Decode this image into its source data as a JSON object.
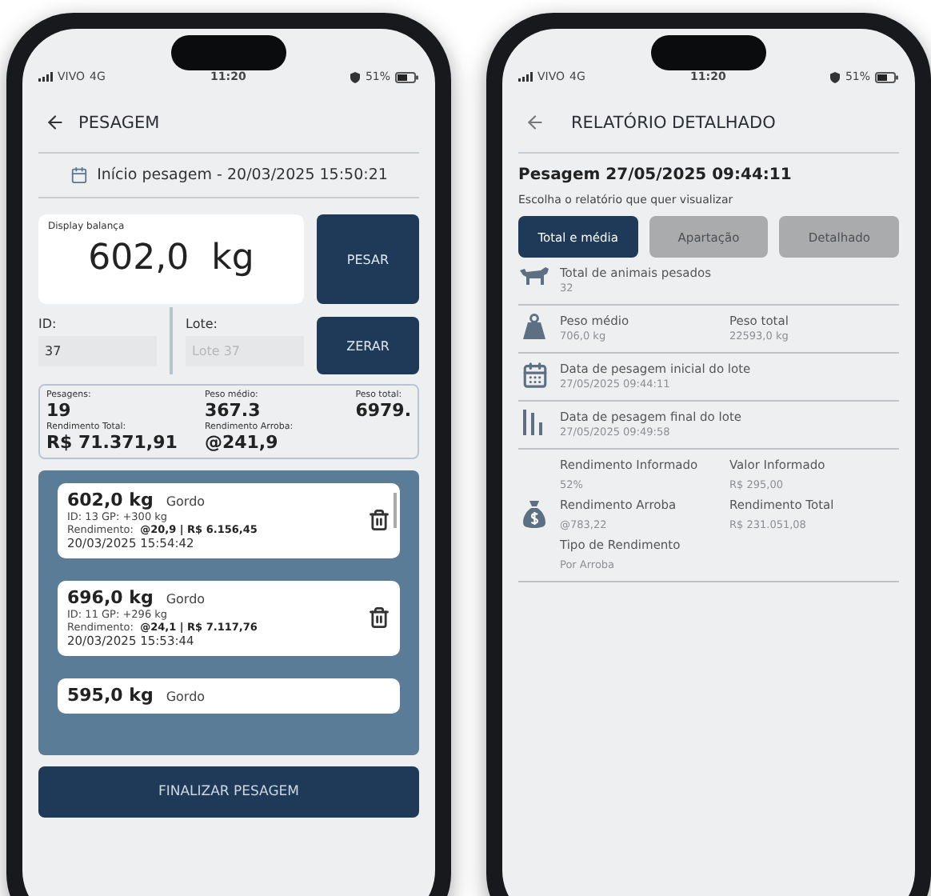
{
  "weighing_screen": {
    "status_bar": {
      "carrier": "VIVO",
      "network": "4G",
      "time": "11:20",
      "battery": "51%"
    },
    "header_title": "PESAGEM",
    "start_info": "Início pesagem - 20/03/2025 15:50:21",
    "scale_display": {
      "label": "Display balança",
      "value": "602,0  kg"
    },
    "weigh_button": "PESAR",
    "reset_button": "ZERAR",
    "id_field": {
      "label": "ID:",
      "value": "37"
    },
    "lot_field": {
      "label": "Lote:",
      "placeholder": "Lote 37"
    },
    "summary": [
      {
        "label": "Pesagens:",
        "value": "19"
      },
      {
        "label": "Peso médio:",
        "value": "367.3"
      },
      {
        "label": "Peso total:",
        "value": "6979."
      },
      {
        "label": "Rendimento Total:",
        "value": "R$ 71.371,91"
      },
      {
        "label": "Rendimento Arroba:",
        "value": "@241,9"
      }
    ],
    "records": [
      {
        "weight": "602,0 kg",
        "category": "Gordo",
        "id_line": "ID: 13  GP: +300 kg",
        "yield_label": "Rendimento:",
        "yield_value": "@20,9 | R$ 6.156,45",
        "date": "20/03/2025 15:54:42"
      },
      {
        "weight": "696,0 kg",
        "category": "Gordo",
        "id_line": "ID: 11  GP: +296 kg",
        "yield_label": "Rendimento:",
        "yield_value": "@24,1 | R$ 7.117,76",
        "date": "20/03/2025 15:53:44"
      },
      {
        "weight": "595,0 kg",
        "category": "Gordo"
      }
    ],
    "finish_button": "FINALIZAR PESAGEM"
  },
  "report_screen": {
    "status_bar": {
      "carrier": "VIVO",
      "network": "4G",
      "time": "11:20",
      "battery": "51%"
    },
    "header_title": "RELATÓRIO DETALHADO",
    "title": "Pesagem 27/05/2025 09:44:11",
    "subtitle": "Escolha o relatório que quer visualizar",
    "tabs": [
      {
        "label": "Total e média",
        "selected": true
      },
      {
        "label": "Apartação",
        "selected": false
      },
      {
        "label": "Detalhado",
        "selected": false
      }
    ],
    "sections": [
      {
        "kind": "cow",
        "fields": [
          {
            "label": "Total de animais pesados",
            "value": "32"
          }
        ]
      },
      {
        "kind": "weight",
        "fields": [
          {
            "label": "Peso médio",
            "value": "706,0 kg"
          },
          {
            "label": "Peso total",
            "value": "22593,0 kg"
          }
        ]
      },
      {
        "kind": "calendar",
        "fields": [
          {
            "label": "Data de pesagem inicial do lote",
            "value": "27/05/2025 09:44:11"
          }
        ]
      },
      {
        "kind": "bars",
        "fields": [
          {
            "label": "Data de pesagem final do lote",
            "value": "27/05/2025 09:49:58"
          }
        ]
      },
      {
        "kind": "money",
        "fields": [
          {
            "label": "Rendimento Informado",
            "value": "52%"
          },
          {
            "label": "Valor Informado",
            "value": "R$ 295,00"
          },
          {
            "label": "Rendimento Arroba",
            "value": "@783,22"
          },
          {
            "label": "Rendimento Total",
            "value": "R$ 231.051,08"
          },
          {
            "label": "Tipo de Rendimento",
            "value": "Por Arroba"
          }
        ]
      }
    ]
  }
}
